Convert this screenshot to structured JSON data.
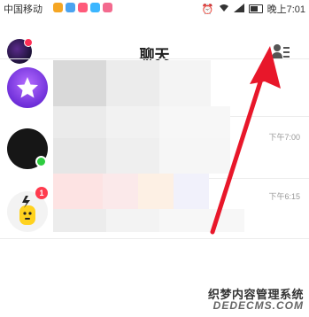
{
  "status_bar": {
    "carrier": "中国移动",
    "time": "晚上7:01"
  },
  "header": {
    "title": "聊天"
  },
  "chats": [
    {
      "time": "",
      "badge": ""
    },
    {
      "time": "下午7:00",
      "badge": ""
    },
    {
      "time": "下午6:15",
      "badge": "1"
    }
  ],
  "watermark": {
    "line1": "织梦内容管理系统",
    "line2": "DEDECMS.COM"
  },
  "colors": {
    "arrow": "#e8172a",
    "badge": "#ff3b4e",
    "online": "#2ecc40"
  }
}
